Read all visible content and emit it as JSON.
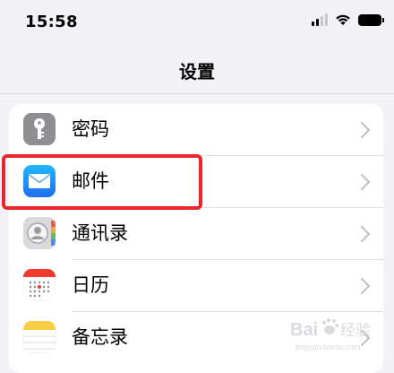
{
  "status_bar": {
    "time": "15:58",
    "icons": [
      "cellular-signal-icon",
      "wifi-icon",
      "battery-icon"
    ]
  },
  "nav": {
    "title": "设置"
  },
  "settings": [
    {
      "label": "密码",
      "icon": "key-icon",
      "icon_color": "#8e8e93"
    },
    {
      "label": "邮件",
      "icon": "mail-icon",
      "icon_color": "#1e88f6",
      "highlighted": true
    },
    {
      "label": "通讯录",
      "icon": "contacts-icon",
      "icon_color": "#b9b9be"
    },
    {
      "label": "日历",
      "icon": "calendar-icon",
      "icon_color": "#f03a2e"
    },
    {
      "label": "备忘录",
      "icon": "notes-icon",
      "icon_color": "#f7cf46"
    }
  ],
  "annotation": {
    "color": "#e8262b"
  },
  "watermark": {
    "text": "Bai 经验",
    "subtext": "jingyan.baidu.com"
  }
}
